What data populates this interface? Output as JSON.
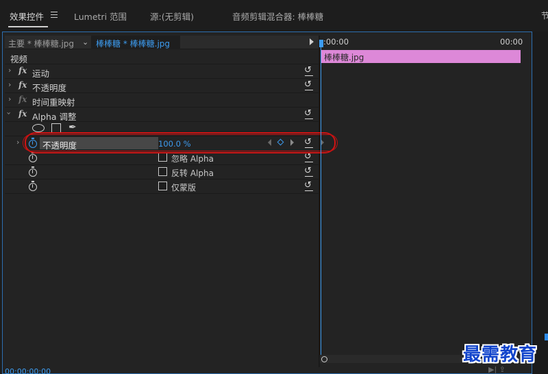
{
  "tabs": [
    {
      "label": "效果控件"
    },
    {
      "label": "Lumetri 范围"
    },
    {
      "label": "源:(无剪辑)"
    },
    {
      "label": "音频剪辑混合器: 棒棒糖"
    },
    {
      "label": "节"
    }
  ],
  "source_bar": {
    "main_label": "主要 * 棒棒糖.jpg",
    "clip_label": "棒棒糖 * 棒棒糖.jpg"
  },
  "section_label": "视频",
  "effects": [
    {
      "label": "运动"
    },
    {
      "label": "不透明度"
    },
    {
      "label": "时间重映射"
    },
    {
      "label": "Alpha 调整"
    }
  ],
  "opacity_param": {
    "label": "不透明度",
    "value": "100.0 %"
  },
  "checkboxes": [
    {
      "label": "忽略 Alpha",
      "checked": false
    },
    {
      "label": "反转 Alpha",
      "checked": false
    },
    {
      "label": "仅蒙版",
      "checked": false
    }
  ],
  "timeline": {
    "start_time": ":00:00",
    "end_time": "00:00",
    "clip_name": "棒棒糖.jpg",
    "clip_color": "#dd88d8"
  },
  "bottom_timecode": "00:00:00:00",
  "bottom_icons": "▶| ⇪",
  "watermark": "最需教育",
  "accent_color": "#3d9cf0",
  "annotation_color": "#d01414"
}
